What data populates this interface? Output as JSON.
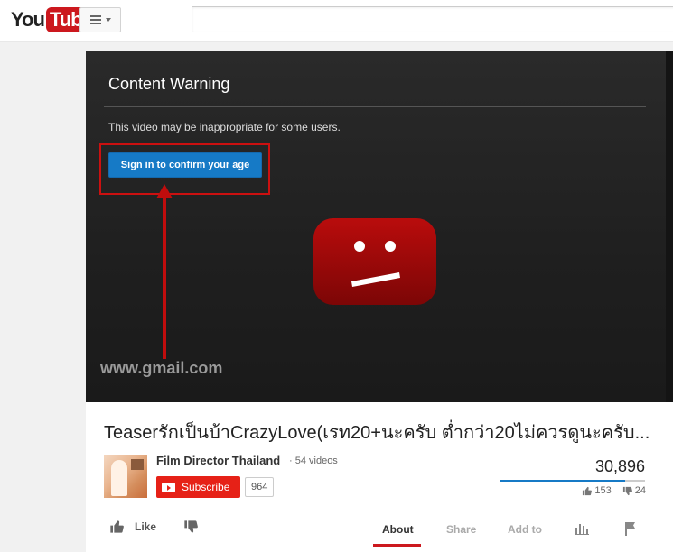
{
  "masthead": {
    "logo_you": "You",
    "logo_tube": "Tube",
    "guide_icon": "menu-icon",
    "search_placeholder": ""
  },
  "player": {
    "warning_title": "Content Warning",
    "warning_text": "This video may be inappropriate for some users.",
    "signin_label": "Sign in to confirm your age",
    "watermark": "www.gmail.com",
    "sad_icon": "sad-tv-icon",
    "accent": "#167ac6",
    "highlight_color": "#cc1010"
  },
  "video": {
    "title": "Teaserรักเป็นบ้าCrazyLove(เรท20+นะครับ ต่ำกว่า20ไม่ควรดูนะครับ...",
    "channel_name": "Film Director Thailand",
    "video_count": "· 54 videos",
    "subscribe_label": "Subscribe",
    "subscriber_count": "964",
    "views": "30,896",
    "likes": "153",
    "dislikes": "24",
    "like_ratio": 0.864
  },
  "actions": {
    "like_label": "Like",
    "tabs": [
      {
        "label": "About",
        "active": true
      },
      {
        "label": "Share",
        "active": false
      },
      {
        "label": "Add to",
        "active": false
      }
    ]
  }
}
